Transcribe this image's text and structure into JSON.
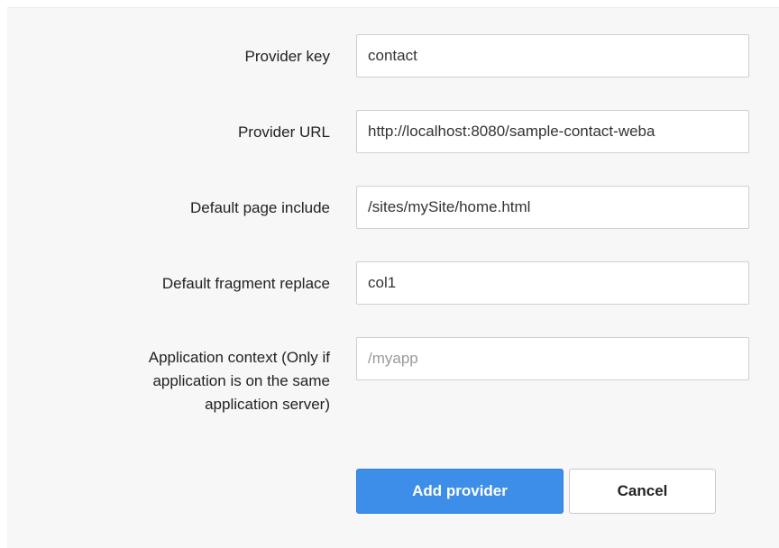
{
  "form": {
    "fields": [
      {
        "label": "Provider key",
        "value": "contact",
        "placeholder": ""
      },
      {
        "label": "Provider URL",
        "value": "http://localhost:8080/sample-contact-weba",
        "placeholder": ""
      },
      {
        "label": "Default page include",
        "value": "/sites/mySite/home.html",
        "placeholder": ""
      },
      {
        "label": "Default fragment replace",
        "value": "col1",
        "placeholder": ""
      },
      {
        "label_lines": [
          "Application context (Only if",
          "application is on the same",
          "application server)"
        ],
        "value": "",
        "placeholder": "/myapp"
      }
    ],
    "add_button_label": "Add provider",
    "cancel_button_label": "Cancel"
  },
  "colors": {
    "primary_button": "#3d8ee8",
    "panel_background": "#f7f7f7"
  }
}
